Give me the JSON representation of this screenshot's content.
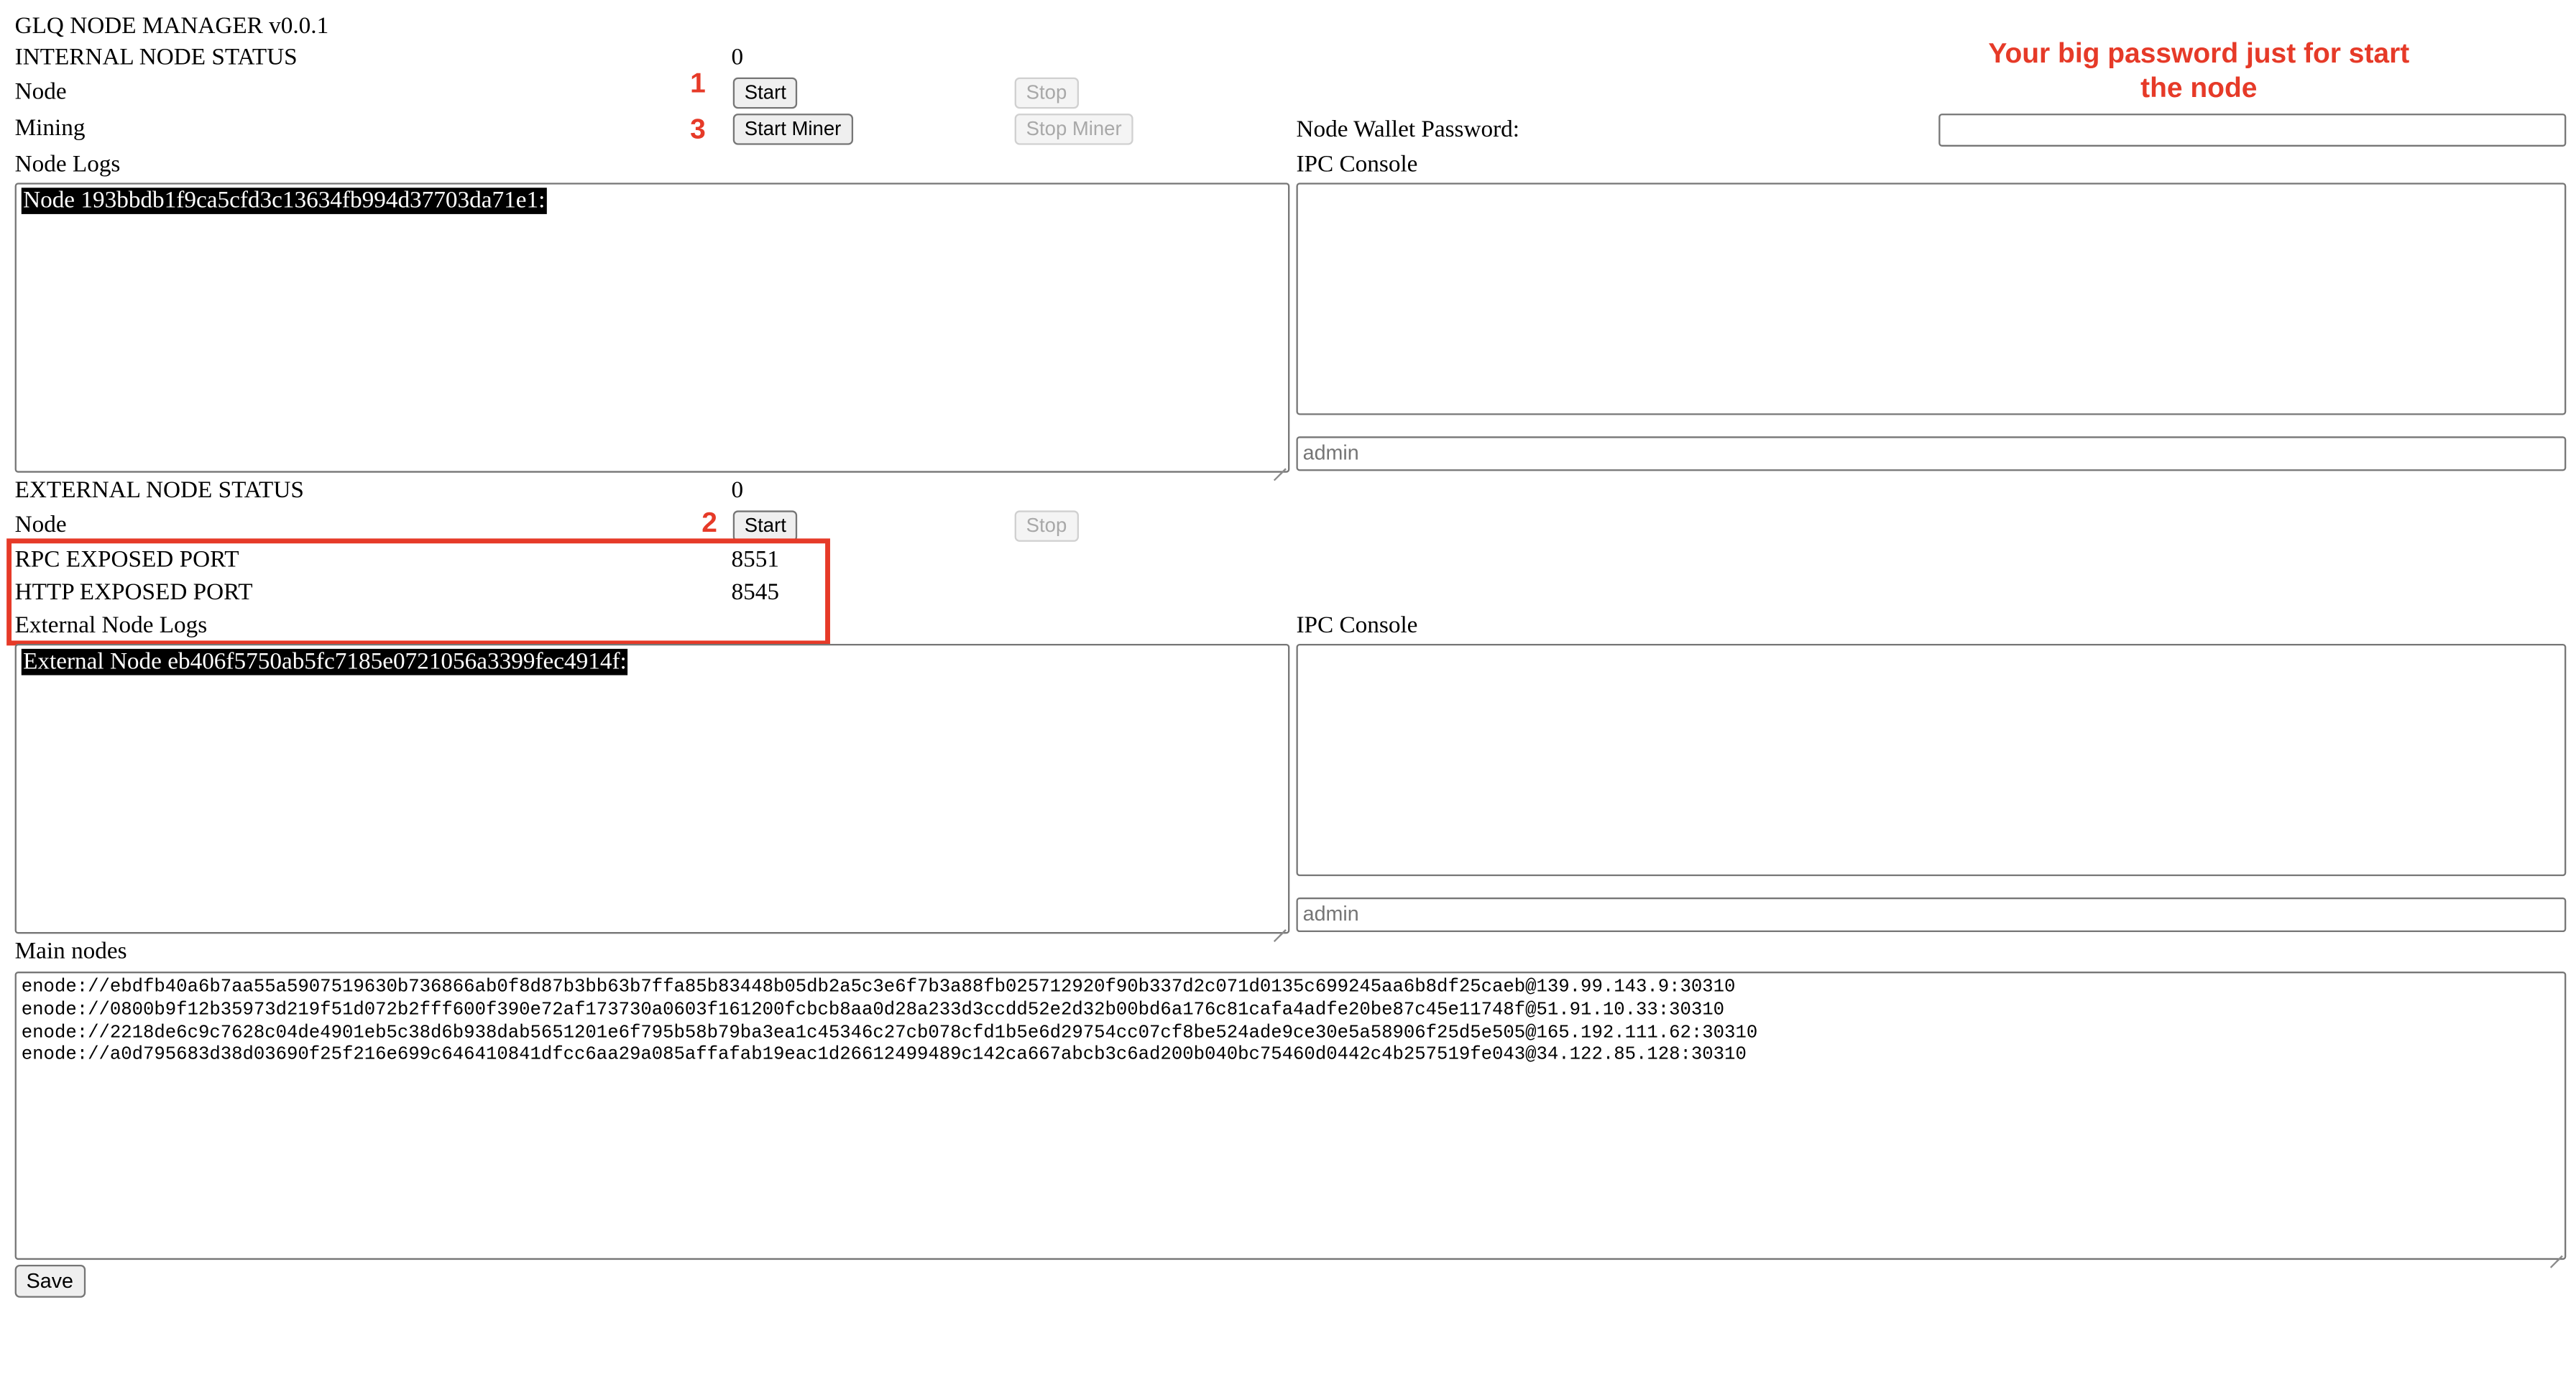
{
  "app": {
    "title": "GLQ NODE MANAGER v0.0.1"
  },
  "internal": {
    "status_label": "INTERNAL NODE STATUS",
    "status_value": "0",
    "node_label": "Node",
    "start_label": "Start",
    "stop_label": "Stop",
    "mining_label": "Mining",
    "start_miner_label": "Start Miner",
    "stop_miner_label": "Stop Miner",
    "logs_label": "Node Logs",
    "logs_text": "Node 193bbdb1f9ca5cfd3c13634fb994d37703da71e1:"
  },
  "wallet": {
    "password_label": "Node Wallet Password:",
    "password_value": ""
  },
  "ipc_internal": {
    "label": "IPC Console",
    "output": "",
    "input_placeholder": "admin"
  },
  "external": {
    "status_label": "EXTERNAL NODE STATUS",
    "status_value": "0",
    "node_label": "Node",
    "start_label": "Start",
    "stop_label": "Stop",
    "rpc_label": "RPC EXPOSED PORT",
    "rpc_value": "8551",
    "http_label": "HTTP EXPOSED PORT",
    "http_value": "8545",
    "logs_label": "External Node Logs",
    "logs_text": "External Node eb406f5750ab5fc7185e0721056a3399fec4914f:"
  },
  "ipc_external": {
    "label": "IPC Console",
    "output": "",
    "input_placeholder": "admin"
  },
  "main_nodes": {
    "label": "Main nodes",
    "text": "enode://ebdfb40a6b7aa55a5907519630b736866ab0f8d87b3bb63b7ffa85b83448b05db2a5c3e6f7b3a88fb025712920f90b337d2c071d0135c699245aa6b8df25caeb@139.99.143.9:30310\nenode://0800b9f12b35973d219f51d072b2fff600f390e72af173730a0603f161200fcbcb8aa0d28a233d3ccdd52e2d32b00bd6a176c81cafa4adfe20be87c45e11748f@51.91.10.33:30310\nenode://2218de6c9c7628c04de4901eb5c38d6b938dab5651201e6f795b58b79ba3ea1c45346c27cb078cfd1b5e6d29754cc07cf8be524ade9ce30e5a58906f25d5e505@165.192.111.62:30310\nenode://a0d795683d38d03690f25f216e699c646410841dfcc6aa29a085affafab19eac1d26612499489c142ca667abcb3c6ad200b040bc75460d0442c4b257519fe043@34.122.85.128:30310",
    "save_label": "Save"
  },
  "annotations": {
    "step1": "1",
    "step2": "2",
    "step3": "3",
    "password_note_line1": "Your big password just for start",
    "password_note_line2": "the node",
    "color": "#e63a28"
  }
}
